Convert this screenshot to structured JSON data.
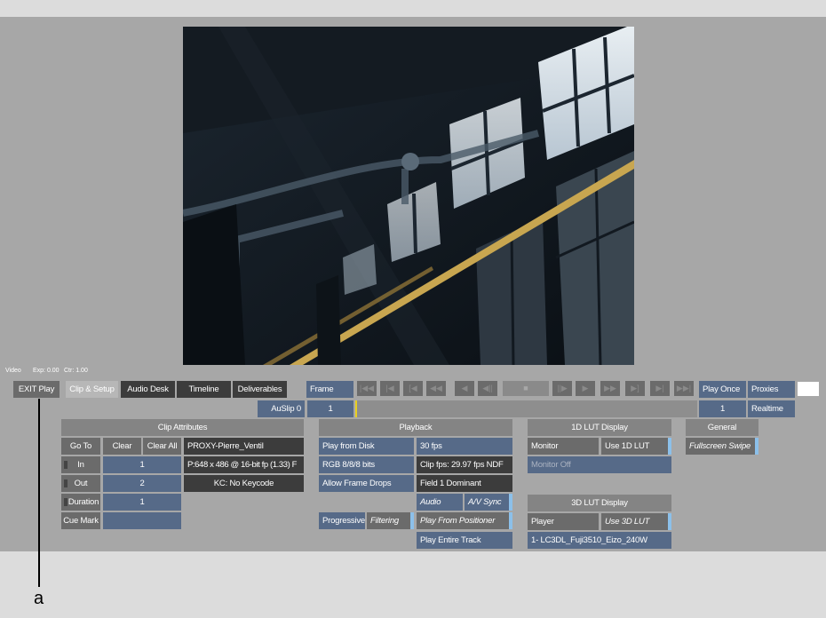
{
  "top_label": {
    "video": "Video",
    "exp": "Exp: 0.00",
    "ctr": "Ctr: 1.00"
  },
  "toolbar": {
    "exit_play": "EXIT Play",
    "tabs": [
      "Clip & Setup",
      "Audio Desk",
      "Timeline",
      "Deliverables"
    ],
    "frame_label": "Frame",
    "auslip": "AuSlip 0",
    "auslip_value": "1",
    "play_once": "Play Once",
    "proxies": "Proxies",
    "frame_value": "1",
    "realtime": "Realtime"
  },
  "transport": {
    "buttons": [
      "|◀◀",
      "|◀",
      "[◀",
      "◀◀",
      "◀",
      "◀||",
      "■",
      "||▶",
      "▶",
      "▶▶",
      "▶]",
      "▶|",
      "▶▶|"
    ]
  },
  "clip_attributes": {
    "header": "Clip Attributes",
    "goto": "Go To",
    "clear": "Clear",
    "clear_all": "Clear All",
    "clip_name": "PROXY-Pierre_Ventil",
    "in_label": "In",
    "in_value": "1",
    "out_label": "Out",
    "out_value": "2",
    "duration_label": "Duration",
    "duration_value": "1",
    "cue_mark": "Cue Mark",
    "format": "P:648 x 486 @ 16-bit fp (1.33) F",
    "keycode": "KC: No Keycode"
  },
  "playback": {
    "header": "Playback",
    "play_from_disk": "Play from Disk",
    "fps": "30 fps",
    "rgb": "RGB 8/8/8 bits",
    "clip_fps": "Clip fps: 29.97 fps NDF",
    "allow_drops": "Allow Frame Drops",
    "field": "Field 1 Dominant",
    "audio": "Audio",
    "av_sync": "A/V Sync",
    "progressive": "Progressive",
    "filtering": "Filtering",
    "play_from_positioner": "Play From Positioner",
    "play_entire_track": "Play Entire Track"
  },
  "lut1d": {
    "header": "1D LUT Display",
    "monitor": "Monitor",
    "use_1d": "Use 1D LUT",
    "monitor_off": "Monitor Off"
  },
  "lut3d": {
    "header": "3D LUT Display",
    "player": "Player",
    "use_3d": "Use 3D LUT",
    "lut_file": "1- LC3DL_Fuji3510_Eizo_240W"
  },
  "general": {
    "header": "General",
    "fullscreen_swipe": "Fullscreen Swipe"
  },
  "callout": {
    "label": "a"
  },
  "colors": {
    "panel": "#a7a7a7",
    "button_gray": "#6b6b6b",
    "button_dark": "#3c3c3c",
    "field_blue": "#566a88",
    "toggle_accent": "#8cc0ea"
  }
}
